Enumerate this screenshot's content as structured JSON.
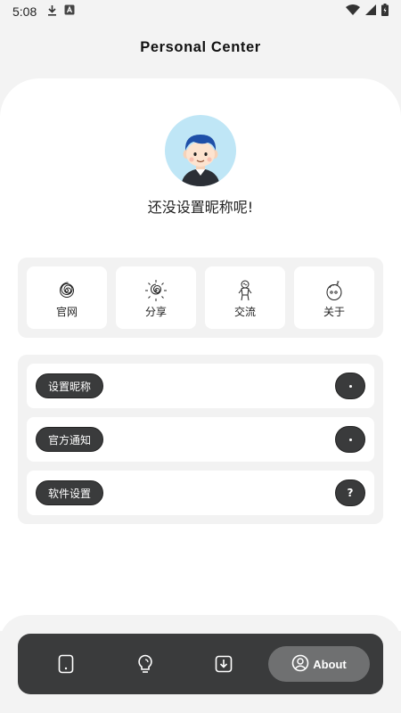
{
  "status_bar": {
    "time": "5:08",
    "left_icons": [
      "download-icon",
      "a-badge-icon"
    ],
    "right_icons": [
      "wifi-icon",
      "signal-icon",
      "battery-icon"
    ]
  },
  "header": {
    "title": "Personal Center"
  },
  "profile": {
    "nickname": "还没设置昵称呢!"
  },
  "quick_actions": [
    {
      "label": "官网",
      "icon": "spiral-icon"
    },
    {
      "label": "分享",
      "icon": "sun-spiral-icon"
    },
    {
      "label": "交流",
      "icon": "person-doodle-icon"
    },
    {
      "label": "关于",
      "icon": "face-doodle-icon"
    }
  ],
  "settings": [
    {
      "label": "设置昵称",
      "badge": "dot"
    },
    {
      "label": "官方通知",
      "badge": "dot"
    },
    {
      "label": "软件设置",
      "badge": "?"
    }
  ],
  "bottom_nav": {
    "items": [
      "phone-icon",
      "lightbulb-icon",
      "download-box-icon"
    ],
    "active_label": "About",
    "active_icon": "user-circle-icon"
  },
  "colors": {
    "dark": "#3a3b3c",
    "panel": "#f2f2f2",
    "avatar_bg": "#bfe6f6"
  }
}
